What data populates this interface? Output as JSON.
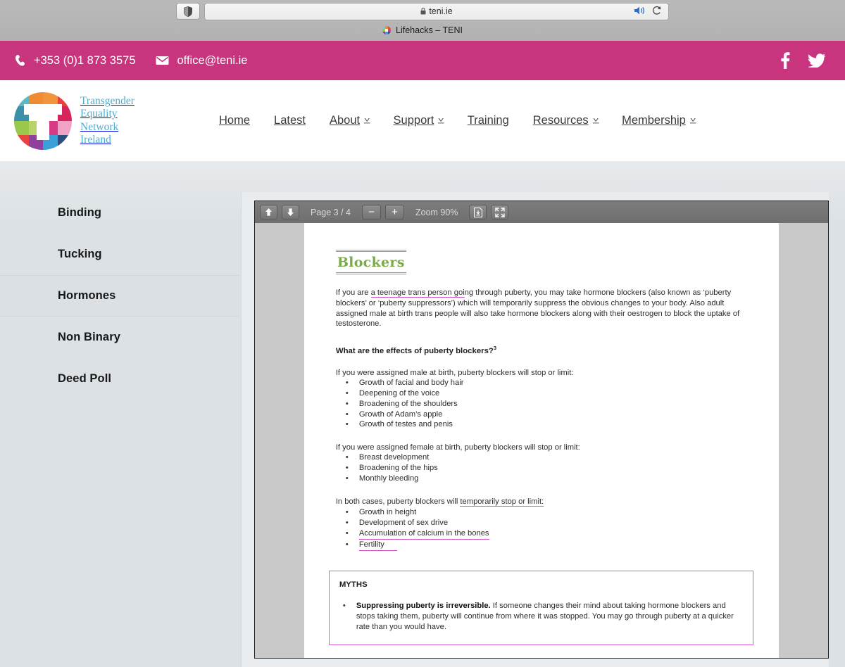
{
  "browser": {
    "shield_icon": "shield-icon",
    "url": "teni.ie",
    "lock_icon": "lock-icon",
    "audio_icon": "speaker-icon",
    "reload_icon": "reload-icon",
    "tab_title": "Lifehacks – TENI",
    "favicon": "teni-favicon"
  },
  "topbar": {
    "phone_icon": "phone-icon",
    "phone": "+353 (0)1 873 3575",
    "mail_icon": "envelope-icon",
    "email": "office@teni.ie",
    "facebook_icon": "facebook-icon",
    "twitter_icon": "twitter-icon",
    "bg_color": "#c8347e"
  },
  "header": {
    "logo_name": "teni-logo",
    "logo_lines": [
      "Transgender",
      "Equality",
      "Network",
      "Ireland"
    ],
    "logo_text_color": "#4eacd0",
    "nav": [
      {
        "label": "Home",
        "dropdown": false
      },
      {
        "label": "Latest",
        "dropdown": false
      },
      {
        "label": "About",
        "dropdown": true
      },
      {
        "label": "Support",
        "dropdown": true
      },
      {
        "label": "Training",
        "dropdown": false
      },
      {
        "label": "Resources",
        "dropdown": true
      },
      {
        "label": "Membership",
        "dropdown": true
      }
    ]
  },
  "sidebar": {
    "items": [
      {
        "label": "Binding",
        "active": false
      },
      {
        "label": "Tucking",
        "active": false
      },
      {
        "label": "Hormones",
        "active": true
      },
      {
        "label": "Non Binary",
        "active": false
      },
      {
        "label": "Deed Poll",
        "active": false
      }
    ]
  },
  "pdf_toolbar": {
    "prev_icon": "arrow-up-icon",
    "next_icon": "arrow-down-icon",
    "page_label": "Page 3 / 4",
    "zoom_out_label": "−",
    "zoom_in_label": "+",
    "zoom_label": "Zoom 90%",
    "download_icon": "download-icon",
    "fullscreen_icon": "fullscreen-icon"
  },
  "document": {
    "title": "Blockers",
    "title_color": "#7aaa4a",
    "intro_pre": "If you are ",
    "intro_highlight": "a teenage trans person goi",
    "intro_post": "ng through puberty, you may take hormone blockers (also known as ‘puberty blockers’ or ‘puberty suppressors’) which will temporarily suppress the obvious changes to your body. Also adult assigned male at birth trans people will also take hormone blockers along with their oestrogen to block the uptake of testosterone.",
    "effects_heading": "What are the effects of puberty blockers?",
    "effects_heading_sup": "3",
    "amab_lead": "If you were assigned male at birth, puberty blockers will stop or limit:",
    "amab_items": [
      "Growth of facial and body hair",
      "Deepening of the voice",
      "Broadening of the shoulders",
      "Growth of Adam’s apple",
      "Growth of testes and penis"
    ],
    "afab_lead": "If you were assigned female at birth, puberty blockers will stop or limit:",
    "afab_items": [
      "Breast development",
      "Broadening of the hips",
      "Monthly bleeding"
    ],
    "both_lead_pre": "In both cases, puberty blockers will ",
    "both_lead_highlight": "temporarily stop or limit:",
    "both_items": [
      {
        "text": "Growth in height",
        "highlight": false
      },
      {
        "text": "Development of sex drive",
        "highlight": false
      },
      {
        "text": "Accumulation of calcium in the bones",
        "highlight": true
      },
      {
        "text": "Fertility",
        "highlight": true
      }
    ],
    "myths_title": "MYTHS",
    "myth_bold": "Suppressing puberty is irreversible.",
    "myth_rest": " If someone changes their mind about taking hormone blockers and stops taking them, puberty will continue from where it was stopped. You may go through puberty at a quicker rate than you would have.",
    "highlight_color": "#d14fc7",
    "box_border_color": "#d45fd0"
  }
}
